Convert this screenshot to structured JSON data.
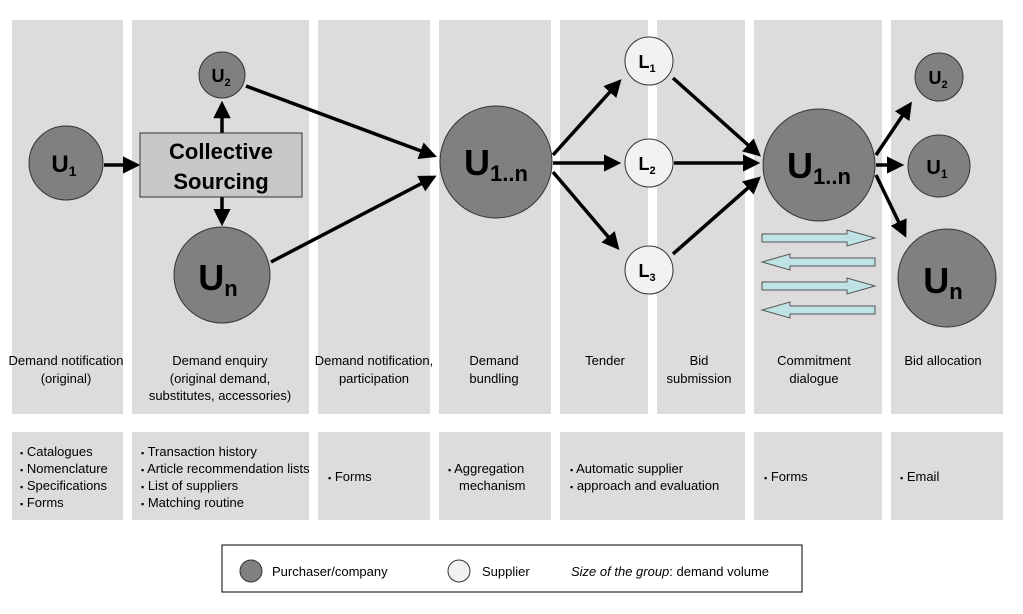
{
  "phases": [
    {
      "label1": "Demand notification",
      "label2": "(original)"
    },
    {
      "label1": "Demand enquiry",
      "label2": "(original demand,",
      "label3": "substitutes, accessories)"
    },
    {
      "label1": "Demand notification,",
      "label2": "participation"
    },
    {
      "label1": "Demand",
      "label2": "bundling"
    },
    {
      "label1": "Tender"
    },
    {
      "label1": "Bid",
      "label2": "submission"
    },
    {
      "label1": "Commitment",
      "label2": "dialogue"
    },
    {
      "label1": "Bid allocation"
    }
  ],
  "tools": [
    [
      "Catalogues",
      "Nomenclature",
      "Specifications",
      "Forms"
    ],
    [
      "Transaction history",
      "Article recommendation lists",
      "List of suppliers",
      "Matching routine"
    ],
    [
      "Forms"
    ],
    [
      "Aggregation",
      "mechanism"
    ],
    [
      "Automatic supplier",
      "approach and evaluation"
    ],
    [
      "Forms"
    ],
    [
      "Email"
    ]
  ],
  "bullet": "▪",
  "nodes": {
    "u1_left": {
      "main": "U",
      "sub": "1"
    },
    "u2_top": {
      "main": "U",
      "sub": "2"
    },
    "un_bottom": {
      "main": "U",
      "sub": "n"
    },
    "collective": {
      "line1": "Collective",
      "line2": "Sourcing"
    },
    "u1n_mid": {
      "main": "U",
      "sub": "1..n"
    },
    "l1": {
      "main": "L",
      "sub": "1"
    },
    "l2": {
      "main": "L",
      "sub": "2"
    },
    "l3": {
      "main": "L",
      "sub": "3"
    },
    "u1n_right": {
      "main": "U",
      "sub": "1..n"
    },
    "u2_right": {
      "main": "U",
      "sub": "2"
    },
    "u1_right": {
      "main": "U",
      "sub": "1"
    },
    "un_right": {
      "main": "U",
      "sub": "n"
    }
  },
  "legend": {
    "purchaser": "Purchaser/company",
    "supplier": "Supplier",
    "size_italic": "Size of the group",
    "size_rest": ": demand volume"
  },
  "colors": {
    "purchaser": "#808080",
    "supplier": "#f2f2f2",
    "phase_bg": "#dcdcdc",
    "dialogue_arrows": "#bfe3e5"
  }
}
